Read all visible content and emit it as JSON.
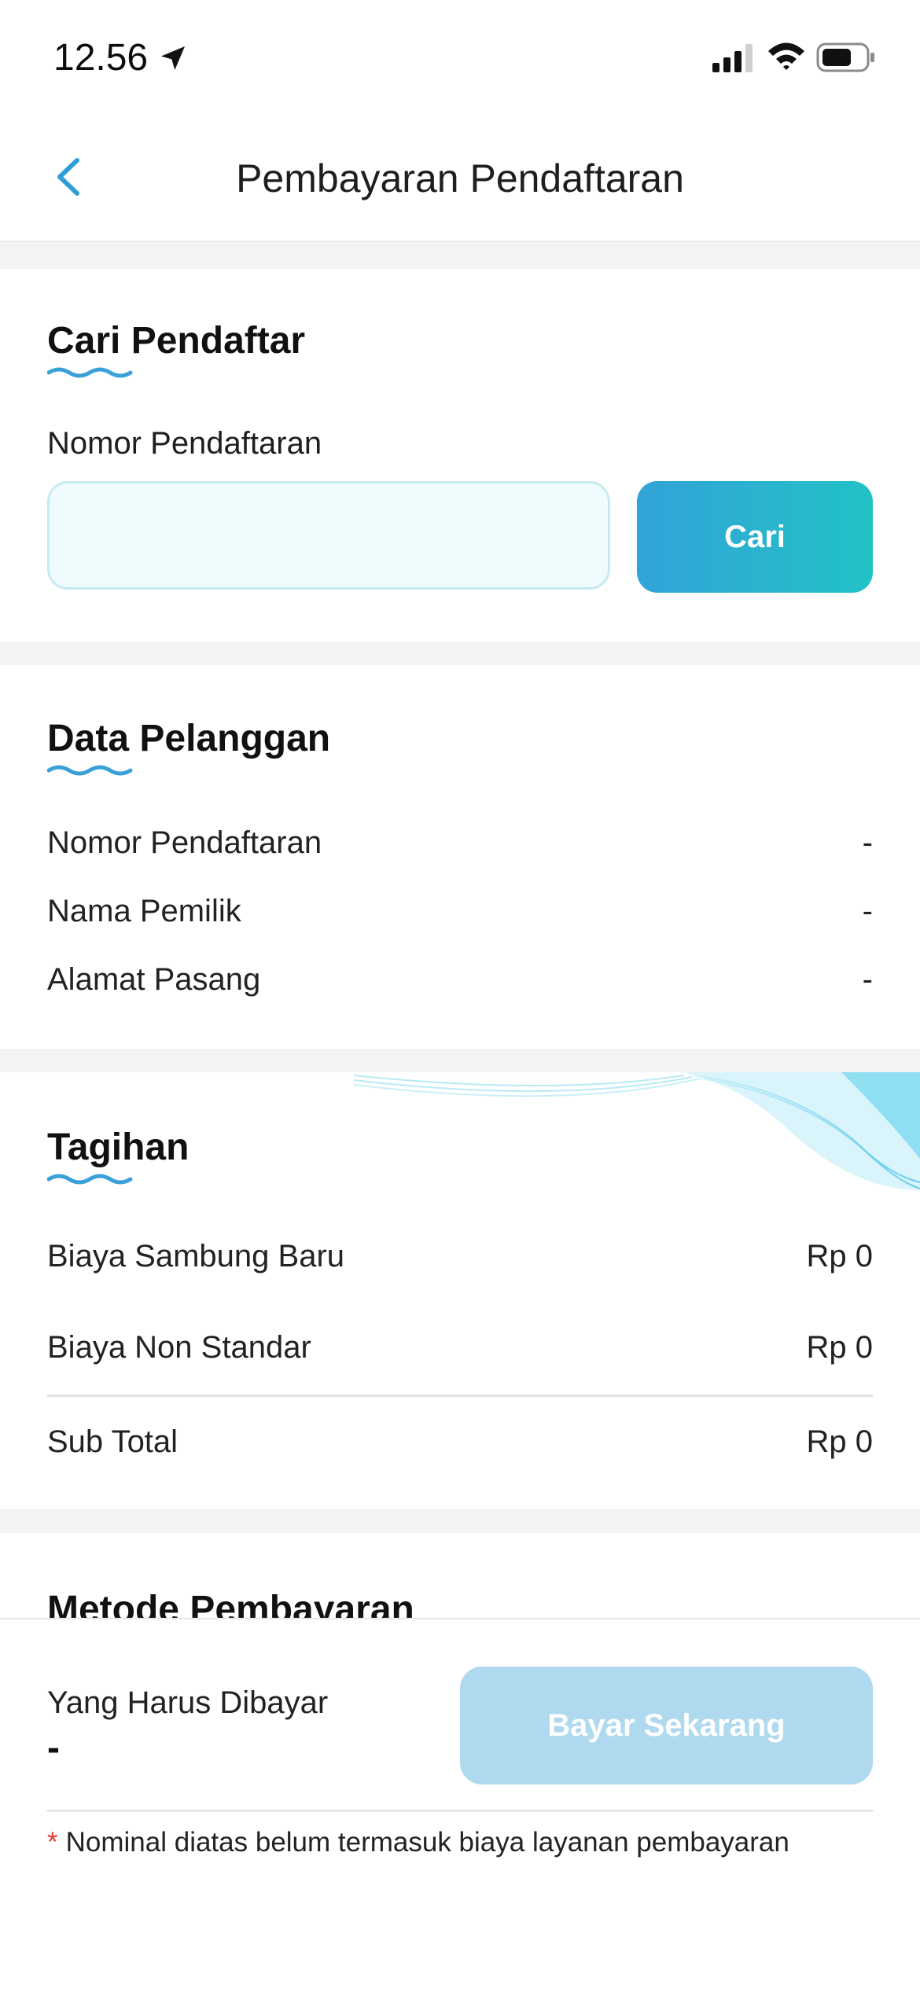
{
  "status_bar": {
    "time": "12.56"
  },
  "header": {
    "title": "Pembayaran Pendaftaran"
  },
  "search_section": {
    "title": "Cari Pendaftar",
    "field_label": "Nomor Pendaftaran",
    "input_value": "",
    "button_label": "Cari"
  },
  "customer_section": {
    "title": "Data Pelanggan",
    "rows": [
      {
        "label": "Nomor Pendaftaran",
        "value": "-"
      },
      {
        "label": "Nama Pemilik",
        "value": "-"
      },
      {
        "label": "Alamat Pasang",
        "value": "-"
      }
    ]
  },
  "bill_section": {
    "title": "Tagihan",
    "rows": [
      {
        "label": "Biaya Sambung Baru",
        "value": "Rp 0"
      },
      {
        "label": "Biaya Non Standar",
        "value": "Rp 0"
      }
    ],
    "subtotal_label": "Sub Total",
    "subtotal_value": "Rp 0"
  },
  "payment_method_section": {
    "title": "Metode Pembayaran"
  },
  "footer": {
    "amount_label": "Yang Harus Dibayar",
    "amount_value": "-",
    "pay_button_label": "Bayar Sekarang",
    "note_asterisk": "*",
    "note": "Nominal diatas belum termasuk biaya layanan pembayaran"
  },
  "colors": {
    "accent": "#2fa3d9",
    "gradient_end": "#22c2c6",
    "disabled_button": "#aed9ee",
    "section_gap": "#f3f3f3"
  }
}
